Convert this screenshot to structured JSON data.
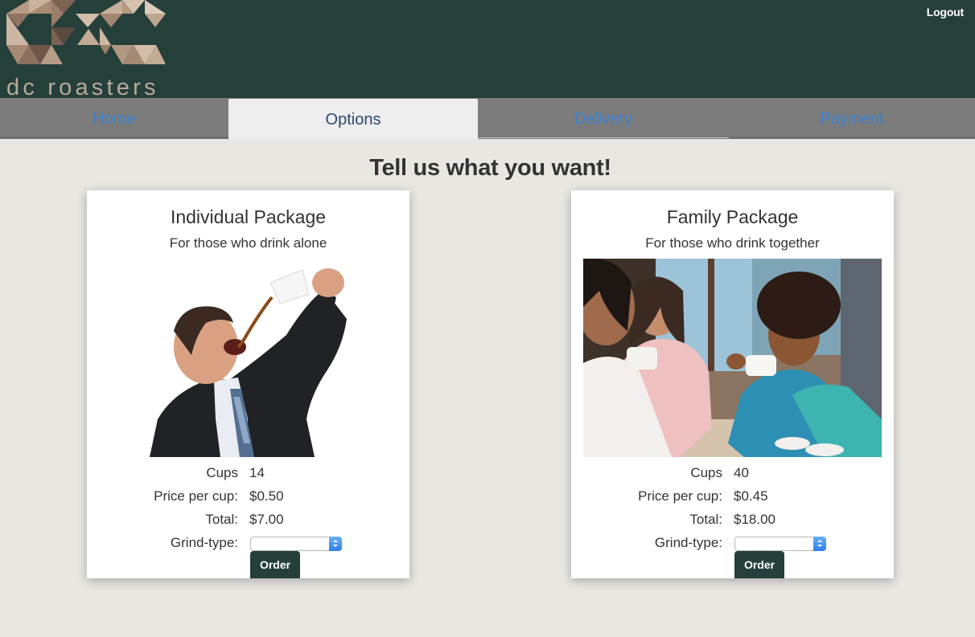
{
  "brand": {
    "name": "dc roasters"
  },
  "header": {
    "logout_label": "Logout"
  },
  "tabs": [
    {
      "label": "Home",
      "active": false
    },
    {
      "label": "Options",
      "active": true
    },
    {
      "label": "Delivery",
      "active": false
    },
    {
      "label": "Payment",
      "active": false
    }
  ],
  "page": {
    "headline": "Tell us what you want!"
  },
  "packages": [
    {
      "title": "Individual Package",
      "subtitle": "For those who drink alone",
      "cups_label": "Cups",
      "cups": "14",
      "price_label": "Price per cup:",
      "price": "$0.50",
      "total_label": "Total:",
      "total": "$7.00",
      "grind_label": "Grind-type:",
      "grind_value": "",
      "order_label": "Order"
    },
    {
      "title": "Family Package",
      "subtitle": "For those who drink together",
      "cups_label": "Cups",
      "cups": "40",
      "price_label": "Price per cup:",
      "price": "$0.45",
      "total_label": "Total:",
      "total": "$18.00",
      "grind_label": "Grind-type:",
      "grind_value": "",
      "order_label": "Order"
    }
  ],
  "colors": {
    "header": "#253f3b",
    "tabbar": "#7c7c7c",
    "tab_link": "#3b82d0",
    "active_tab_text": "#2b4770",
    "background": "#e8e7e2",
    "button": "#253f3b"
  }
}
